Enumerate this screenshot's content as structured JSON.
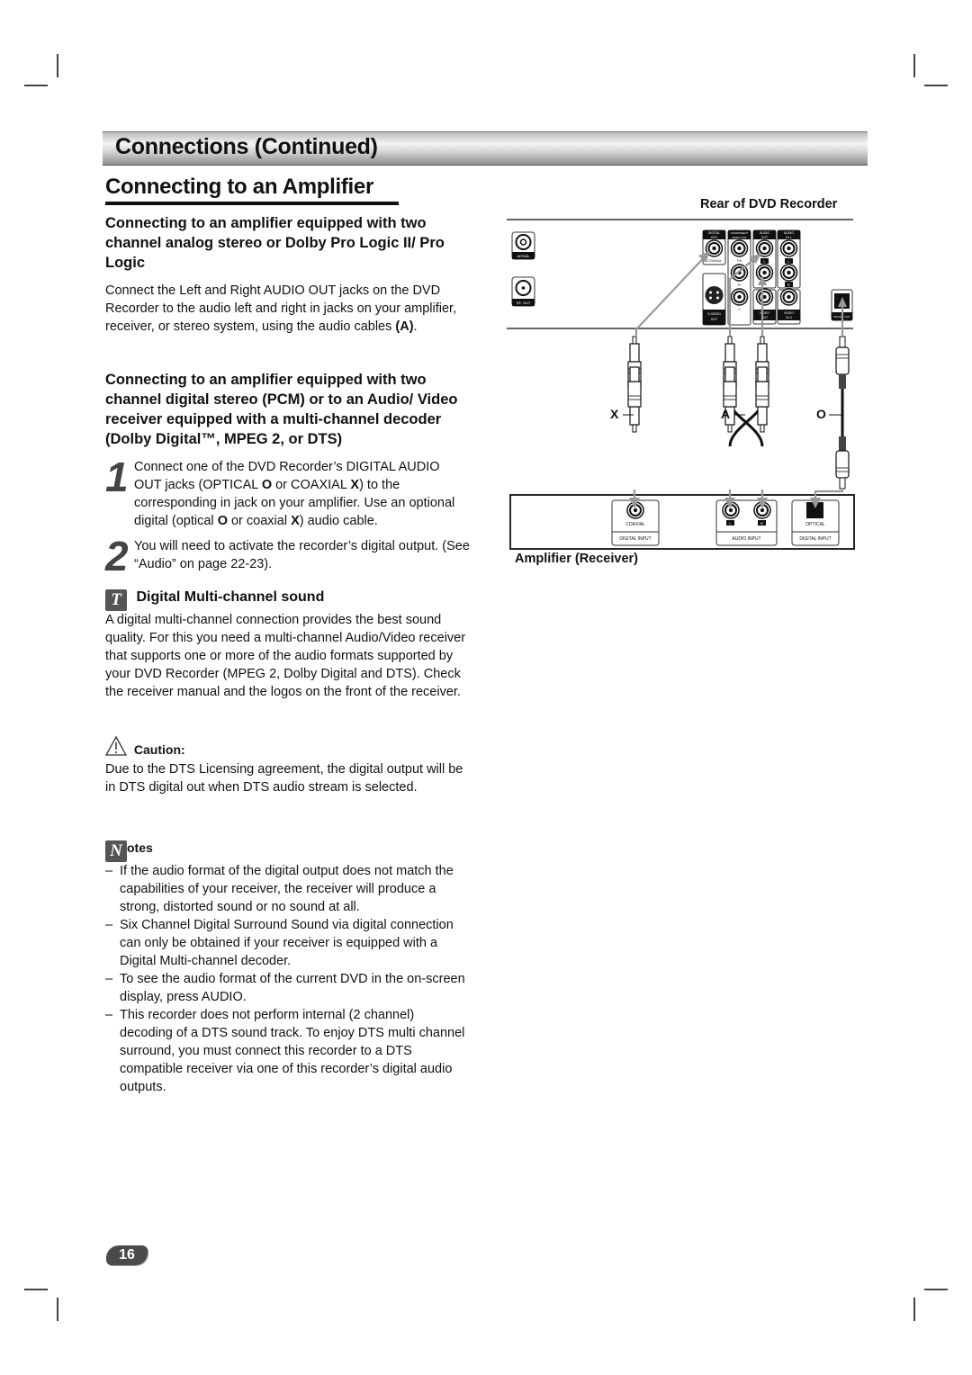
{
  "header": {
    "section_title": "Connections (Continued)",
    "page_title": "Connecting to an Amplifier"
  },
  "analog": {
    "heading": "Connecting to an amplifier equipped with two channel analog stereo or Dolby Pro Logic II/ Pro Logic",
    "body_before": "Connect the Left and Right AUDIO OUT jacks on the DVD Recorder to the audio left and right in jacks on your amplifier, receiver, or stereo system, using the audio cables ",
    "body_bold": "(A)",
    "body_after": "."
  },
  "digital": {
    "heading": "Connecting to an amplifier equipped with two channel digital stereo (PCM) or to an Audio/ Video receiver equipped with a multi-channel decoder (Dolby Digital™, MPEG 2, or DTS)",
    "steps": [
      {
        "number": "1",
        "parts": [
          "Connect one of the DVD Recorder’s DIGITAL AUDIO OUT jacks (OPTICAL ",
          "O",
          " or COAXIAL ",
          "X",
          ") to the corresponding in jack on your amplifier. Use an optional digital (optical ",
          "O",
          " or coaxial ",
          "X",
          ") audio cable."
        ]
      },
      {
        "number": "2",
        "text": "You will need to activate the recorder’s digital output. (See “Audio” on page 22-23)."
      }
    ]
  },
  "tip": {
    "icon_glyph": "T",
    "heading": "Digital Multi-channel sound",
    "body": "A digital multi-channel connection provides the best sound quality. For this you need a multi-channel Audio/Video receiver that supports one or more of the audio formats supported by your DVD Recorder (MPEG 2, Dolby Digital and DTS). Check the receiver manual and the logos on the front of the receiver."
  },
  "caution": {
    "heading": "Caution:",
    "body": "Due to the DTS Licensing agreement, the digital output will be in DTS digital out when DTS audio stream is selected."
  },
  "notes": {
    "icon_glyph": "N",
    "heading": "otes",
    "dash": "–",
    "items": [
      "If the audio format of the digital output does not match the capabilities of your receiver, the receiver will produce a strong, distorted sound or no sound at all.",
      "Six Channel Digital Surround Sound via digital connection can only be obtained if your receiver is equipped with a Digital Multi-channel decoder.",
      "To see the audio format of the current DVD in the on-screen display, press AUDIO.",
      "This recorder does not perform internal (2 channel) decoding of a DTS sound track. To enjoy DTS multi channel surround, you must connect this recorder to a DTS compatible receiver via one of this recorder’s digital audio outputs."
    ]
  },
  "diagram": {
    "recorder_label": "Rear of DVD Recorder",
    "amplifier_label": "Amplifier (Receiver)",
    "recorder_jacks": {
      "aerial": "AERIAL",
      "rf_out": "RF. OUT",
      "digital_out": [
        "DIGITAL",
        "OUT"
      ],
      "coaxial": "COAXIAL",
      "component": [
        "COMPONENT",
        "VIDEO OUT"
      ],
      "pb": "Pb",
      "pr": "Pr",
      "y": "Y",
      "audio_out": [
        "AUDIO",
        "OUT"
      ],
      "audio_in1": [
        "AUDIO",
        "IN 1"
      ],
      "l": "L",
      "r": "R",
      "svideo_out": [
        "S-VIDEO",
        "OUT"
      ],
      "video_out": [
        "VIDEO",
        "OUT"
      ],
      "video_in3": [
        "VIDEO",
        "IN 3"
      ],
      "optical_out": "DIGITAL OUT"
    },
    "cables": {
      "coaxial": "X",
      "audio": "A",
      "optical": "O"
    },
    "amplifier_jacks": {
      "coaxial": "COAXIAL",
      "digital_input": "DIGITAL INPUT",
      "l": "L",
      "r": "R",
      "audio_input": "AUDIO INPUT",
      "optical": "OPTICAL",
      "digital_input_2": "DIGITAL INPUT"
    }
  },
  "footer": {
    "page_number": "16"
  }
}
